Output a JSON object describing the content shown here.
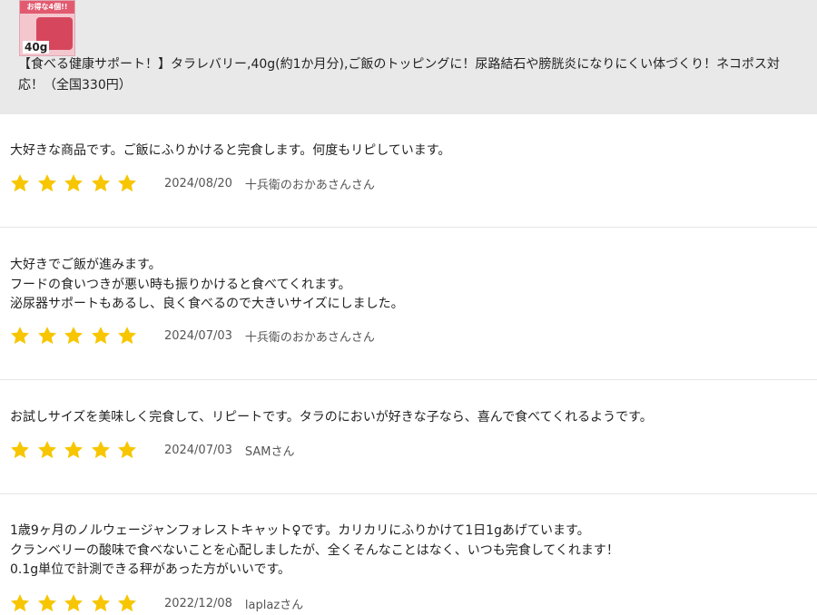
{
  "product": {
    "thumbnail_banner": "お得な4個!!",
    "thumbnail_weight": "40g",
    "title": "【食べる健康サポート！】タラレバリー,40g(約1か月分),ご飯のトッピングに！尿路結石や膀胱炎になりにくい体づくり！ネコポス対応！（全国330円）"
  },
  "star_color": "#f7c600",
  "reviews": [
    {
      "text": "大好きな商品です。ご飯にふりかけると完食します。何度もリピしています。",
      "rating": 5,
      "date": "2024/08/20",
      "author": "十兵衛のおかあさんさん"
    },
    {
      "text": "大好きでご飯が進みます。\nフードの食いつきが悪い時も振りかけると食べてくれます。\n泌尿器サポートもあるし、良く食べるので大きいサイズにしました。",
      "rating": 5,
      "date": "2024/07/03",
      "author": "十兵衛のおかあさんさん"
    },
    {
      "text": "お試しサイズを美味しく完食して、リピートです。タラのにおいが好きな子なら、喜んで食べてくれるようです。",
      "rating": 5,
      "date": "2024/07/03",
      "author": "SAMさん"
    },
    {
      "text": "1歳9ヶ月のノルウェージャンフォレストキャット♀です。カリカリにふりかけて1日1gあげています。\nクランベリーの酸味で食べないことを心配しましたが、全くそんなことはなく、いつも完食してくれます！\n0.1g単位で計測できる秤があった方がいいです。",
      "rating": 5,
      "date": "2022/12/08",
      "author": "laplazさん"
    }
  ]
}
